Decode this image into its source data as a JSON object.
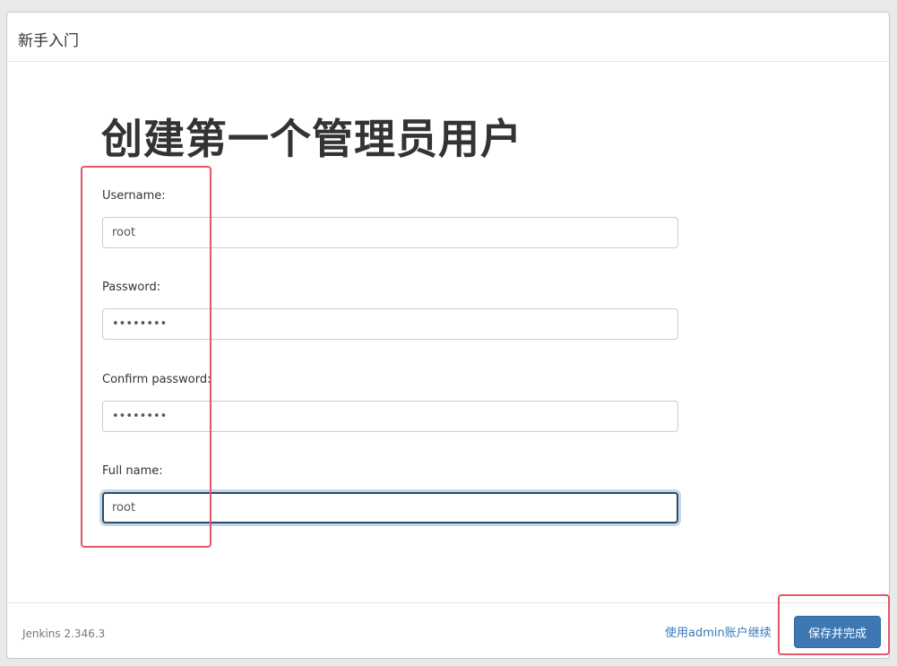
{
  "dialog": {
    "title": "新手入门"
  },
  "main": {
    "heading": "创建第一个管理员用户"
  },
  "form": {
    "username": {
      "label": "Username:",
      "value": "root"
    },
    "password": {
      "label": "Password:",
      "value": "••••••••"
    },
    "confirm_password": {
      "label": "Confirm password:",
      "value": "••••••••"
    },
    "full_name": {
      "label": "Full name:",
      "value": "root"
    }
  },
  "footer": {
    "version": "Jenkins 2.346.3",
    "continue_link": "使用admin账户继续",
    "save_button": "保存并完成"
  },
  "colors": {
    "accent": "#3f77b3",
    "link": "#3a7ab8",
    "highlight": "#e0586a"
  }
}
